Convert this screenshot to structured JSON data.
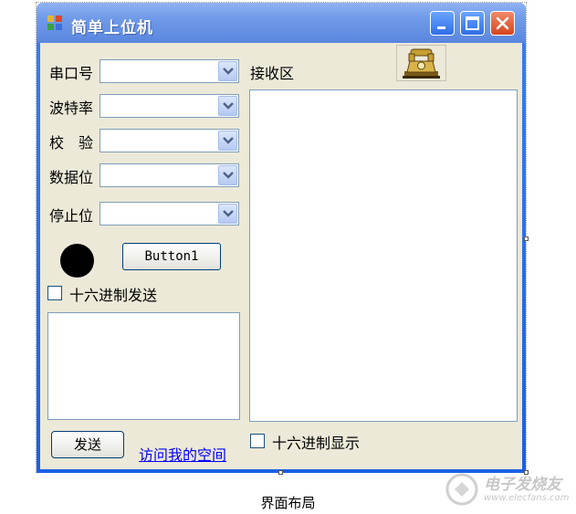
{
  "window": {
    "title": "简单上位机"
  },
  "serial_settings": [
    {
      "label": "串口号",
      "value": ""
    },
    {
      "label": "波特率",
      "value": ""
    },
    {
      "label": "校　验",
      "value": ""
    },
    {
      "label": "数据位",
      "value": ""
    },
    {
      "label": "停止位",
      "value": ""
    }
  ],
  "controls": {
    "button1_label": "Button1",
    "hex_send_label": "十六进制发送",
    "send_button_label": "发送",
    "visit_link_label": "访问我的空间"
  },
  "receive": {
    "label": "接收区",
    "hex_display_label": "十六进制显示",
    "content": ""
  },
  "send_box": {
    "content": ""
  },
  "caption": "界面布局",
  "watermark": {
    "text": "电子发烧友",
    "url": "www.elecfans.com"
  },
  "colors": {
    "titlebar": "#6f9ae9",
    "client_bg": "#ece9d8",
    "close_button": "#d6451d",
    "link": "#0000ff"
  }
}
